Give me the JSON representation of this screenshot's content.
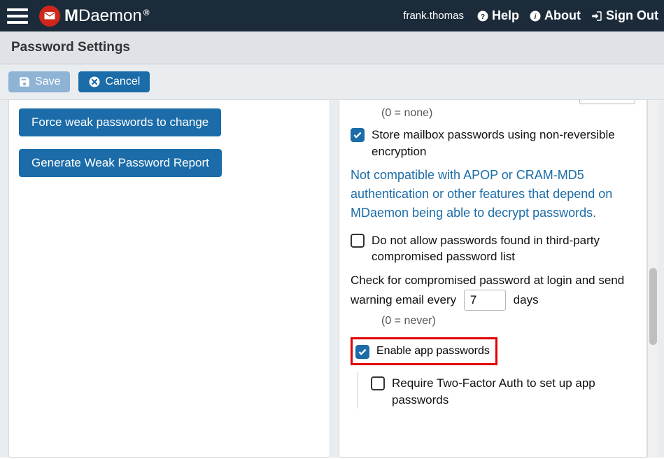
{
  "topbar": {
    "user": "frank.thomas",
    "help": "Help",
    "about": "About",
    "signout": "Sign Out",
    "brand_main": "M",
    "brand_rest": "Daemon",
    "brand_reg": "®"
  },
  "page": {
    "title": "Password Settings"
  },
  "toolbar": {
    "save": "Save",
    "cancel": "Cancel"
  },
  "left": {
    "force_change": "Force weak passwords to change",
    "gen_report": "Generate Weak Password Report"
  },
  "right": {
    "none_hint": "(0 = none)",
    "store_nonreversible": "Store mailbox passwords using non-reversible encryption",
    "incompat_note": "Not compatible with APOP or CRAM-MD5 authentication or other features that depend on MDaemon being able to decrypt passwords.",
    "no_compromised": "Do not allow passwords found in third-party compromised password list",
    "check_prefix": "Check for compromised password at login and send warning email every",
    "check_value": "7",
    "check_suffix": "days",
    "never_hint": "(0 = never)",
    "enable_app": "Enable app passwords",
    "require_2fa": "Require Two-Factor Auth to set up app passwords"
  }
}
